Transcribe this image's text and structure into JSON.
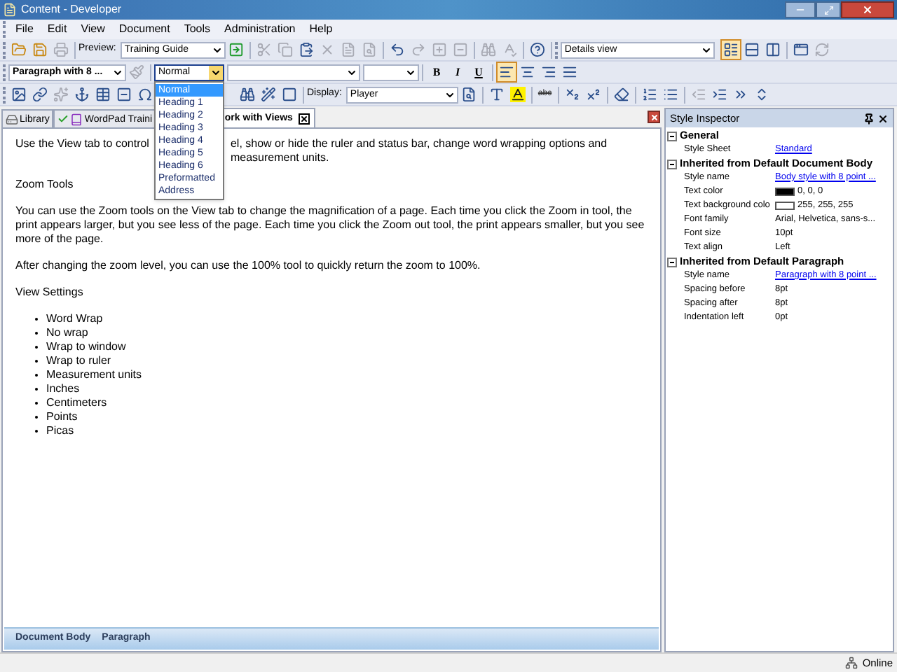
{
  "window": {
    "title": "Content - Developer"
  },
  "menu": [
    "File",
    "Edit",
    "View",
    "Document",
    "Tools",
    "Administration",
    "Help"
  ],
  "main_toolbar": {
    "file_buttons": [
      {
        "disabled": false
      },
      {
        "disabled": false
      },
      {
        "disabled": true
      }
    ],
    "preview_label": "Preview:",
    "preview_value": "Training Guide",
    "edit_buttons": [
      {
        "disabled": false
      },
      {
        "disabled": true
      },
      {
        "disabled": true
      },
      {
        "disabled": false
      },
      {
        "disabled": true
      },
      {
        "disabled": true
      },
      {
        "disabled": true
      },
      {
        "disabled": false
      },
      {
        "disabled": true
      },
      {
        "disabled": true
      },
      {
        "disabled": true
      },
      {
        "disabled": true
      },
      {
        "disabled": true
      },
      {
        "disabled": false
      }
    ],
    "view_value": "Details view",
    "view_buttons": [
      {
        "selected": true
      },
      {
        "selected": false
      },
      {
        "selected": false
      }
    ],
    "extra_buttons": [
      {
        "disabled": false
      },
      {
        "disabled": true
      }
    ]
  },
  "format_toolbar": {
    "style_value": "Paragraph with 8 ...",
    "block_format": {
      "value": "Normal",
      "expanded": true,
      "options": [
        {
          "label": "Normal",
          "selected": true
        },
        {
          "label": "Heading 1",
          "selected": false
        },
        {
          "label": "Heading 2",
          "selected": false
        },
        {
          "label": "Heading 3",
          "selected": false
        },
        {
          "label": "Heading 4",
          "selected": false
        },
        {
          "label": "Heading 5",
          "selected": false
        },
        {
          "label": "Heading 6",
          "selected": false
        },
        {
          "label": "Preformatted",
          "selected": false
        },
        {
          "label": "Address",
          "selected": false
        }
      ]
    },
    "bold": "B",
    "italic": "I",
    "underline": "U",
    "alignment": [
      {
        "selected": true
      },
      {
        "selected": false
      },
      {
        "selected": false
      },
      {
        "selected": false
      }
    ]
  },
  "insert_toolbar": {
    "display_label": "Display:",
    "display_value": "Player",
    "strike_label": "abc"
  },
  "tabs": [
    {
      "label": "Library",
      "selected": false,
      "closable": false
    },
    {
      "label": "WordPad Traini",
      "selected": false,
      "closable": false
    },
    {
      "label": "ork with Views",
      "selected": true,
      "closable": true
    }
  ],
  "document": [
    {
      "kind": "para",
      "parts": [
        "Use the View tab to control",
        "el, show or hide the ruler and status bar, change word wrapping options and measurement units."
      ]
    },
    {
      "kind": "para",
      "parts": [
        "Zoom Tools"
      ]
    },
    {
      "kind": "para",
      "parts": [
        "You can use the Zoom tools on the View tab to change the magnification of a page. Each time you click the Zoom in tool, the print appears larger, but you see less of the page. Each time you click the Zoom out tool, the print appears smaller, but you see more of the page."
      ]
    },
    {
      "kind": "para",
      "parts": [
        "After changing the zoom level, you can use the 100% tool to quickly return the zoom to 100%."
      ]
    },
    {
      "kind": "para",
      "parts": [
        "View Settings"
      ]
    },
    {
      "kind": "list",
      "items": [
        "Word Wrap",
        "No wrap",
        "Wrap to window",
        "Wrap to ruler",
        "Measurement units",
        "Inches",
        "Centimeters",
        "Points",
        "Picas"
      ]
    }
  ],
  "breadcrumb": [
    "Document Body",
    "Paragraph"
  ],
  "inspector": {
    "title": "Style Inspector",
    "sections": [
      {
        "title": "General",
        "expanded": true,
        "rows": [
          {
            "kind": "link",
            "label": "Style Sheet",
            "value": "Standard"
          }
        ]
      },
      {
        "title": "Inherited from Default Document Body",
        "expanded": true,
        "rows": [
          {
            "kind": "link",
            "label": "Style name",
            "value": "Body style with 8 point ..."
          },
          {
            "kind": "color",
            "label": "Text color",
            "value": "0, 0, 0",
            "color": "#000000"
          },
          {
            "kind": "color",
            "label": "Text background colo",
            "value": "255, 255, 255",
            "color": "#ffffff"
          },
          {
            "kind": "text",
            "label": "Font family",
            "value": "Arial, Helvetica, sans-s..."
          },
          {
            "kind": "text",
            "label": "Font size",
            "value": "10pt"
          },
          {
            "kind": "text",
            "label": "Text align",
            "value": "Left"
          }
        ]
      },
      {
        "title": "Inherited from Default Paragraph",
        "expanded": true,
        "rows": [
          {
            "kind": "link",
            "label": "Style name",
            "value": "Paragraph with 8 point ..."
          },
          {
            "kind": "text",
            "label": "Spacing before",
            "value": "8pt"
          },
          {
            "kind": "text",
            "label": "Spacing after",
            "value": "8pt"
          },
          {
            "kind": "text",
            "label": "Indentation left",
            "value": "0pt"
          }
        ]
      }
    ]
  },
  "status": {
    "label": "Online"
  }
}
